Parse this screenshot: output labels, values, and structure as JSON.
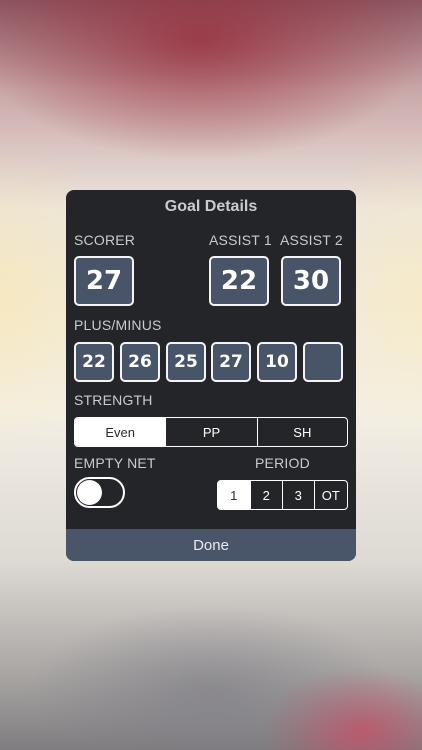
{
  "dialog": {
    "title": "Goal Details",
    "scorer": {
      "label": "SCORER",
      "number": "27"
    },
    "assist1": {
      "label": "ASSIST 1",
      "number": "22"
    },
    "assist2": {
      "label": "ASSIST 2",
      "number": "30"
    },
    "plus_minus": {
      "label": "PLUS/MINUS",
      "numbers": [
        "22",
        "26",
        "25",
        "27",
        "10",
        ""
      ]
    },
    "strength": {
      "label": "STRENGTH",
      "options": [
        "Even",
        "PP",
        "SH"
      ],
      "selected": "Even"
    },
    "empty_net": {
      "label": "EMPTY NET",
      "on": false
    },
    "period": {
      "label": "PERIOD",
      "options": [
        "1",
        "2",
        "3",
        "OT"
      ],
      "selected": "1"
    },
    "done_label": "Done"
  },
  "colors": {
    "dialog_bg": "#242528",
    "jersey_fill": "#485468",
    "done_bar": "#495568",
    "label_text": "#c9cbcf"
  }
}
